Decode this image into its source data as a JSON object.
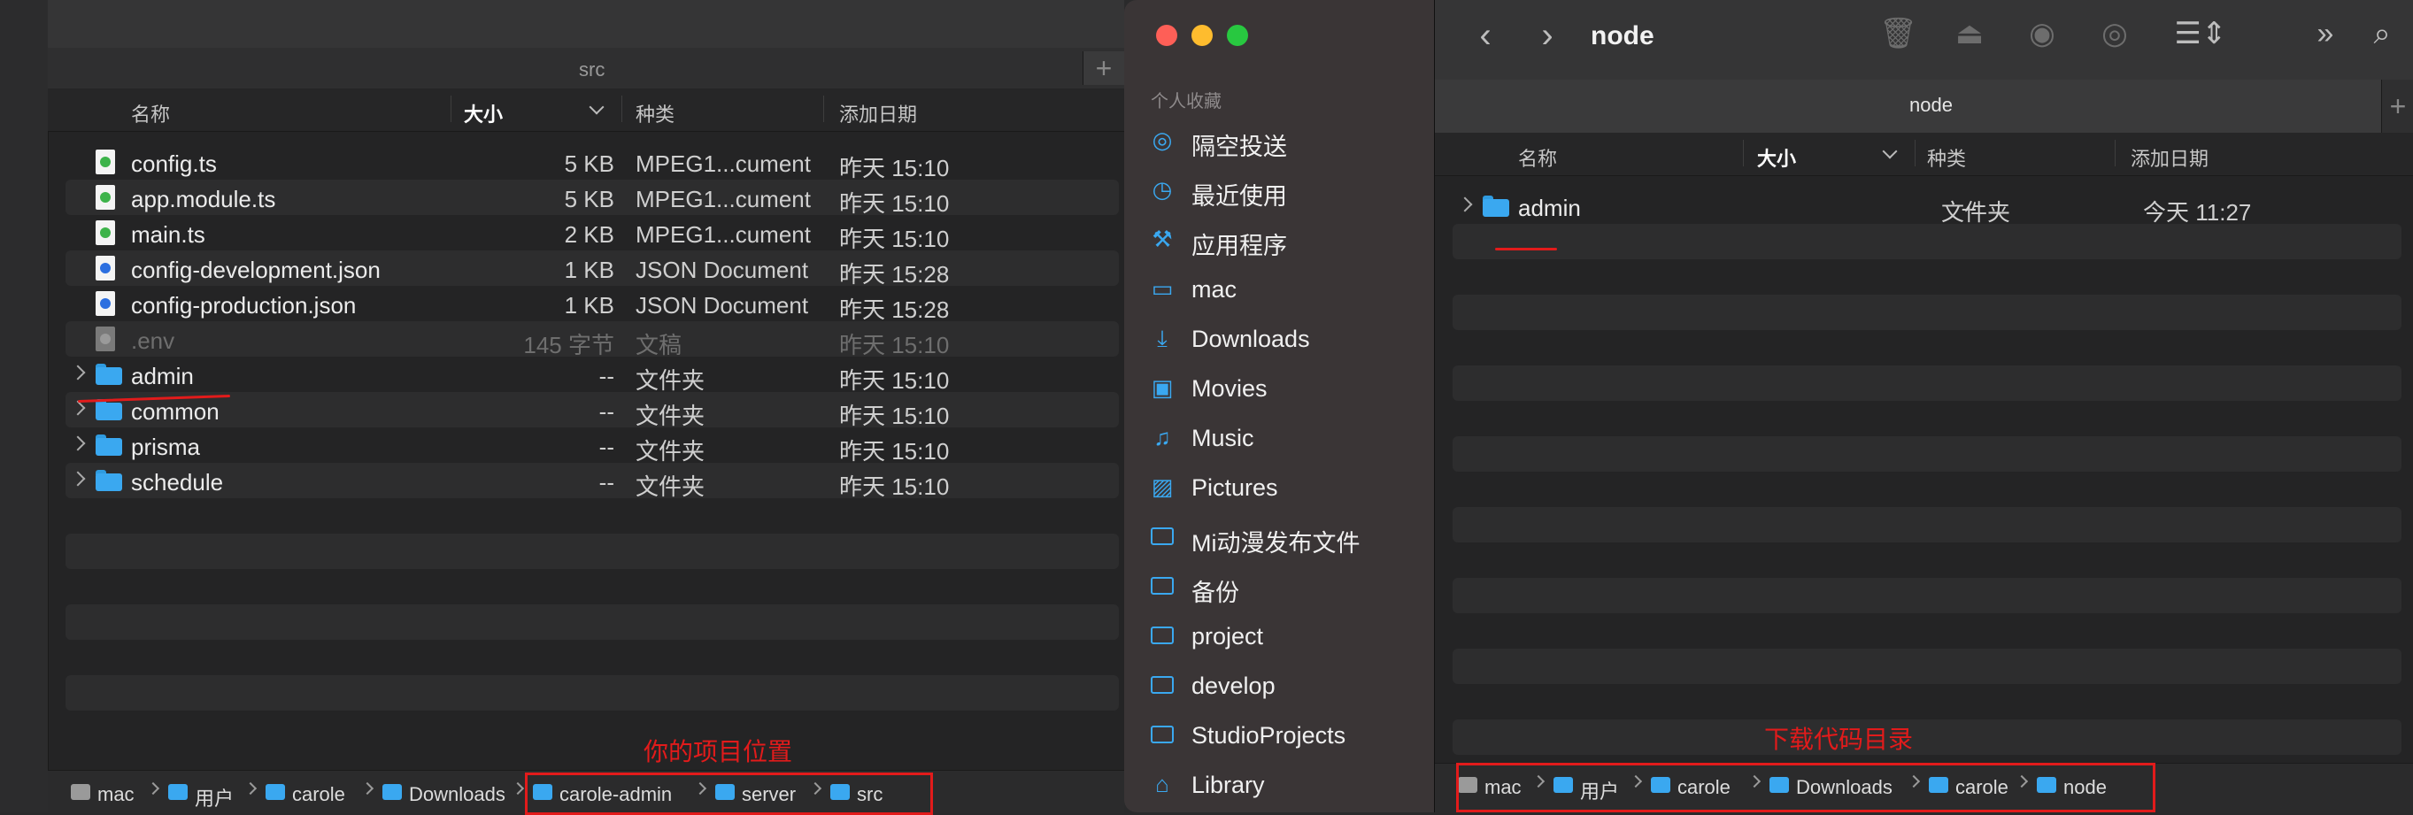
{
  "left_window": {
    "tab_title": "src",
    "columns": {
      "name": "名称",
      "size": "大小",
      "kind": "种类",
      "date": "添加日期"
    },
    "files": [
      {
        "name": "config.ts",
        "size": "5 KB",
        "kind": "MPEG1...cument",
        "date": "昨天 15:10",
        "type": "ts"
      },
      {
        "name": "app.module.ts",
        "size": "5 KB",
        "kind": "MPEG1...cument",
        "date": "昨天 15:10",
        "type": "ts"
      },
      {
        "name": "main.ts",
        "size": "2 KB",
        "kind": "MPEG1...cument",
        "date": "昨天 15:10",
        "type": "ts"
      },
      {
        "name": "config-development.json",
        "size": "1 KB",
        "kind": "JSON Document",
        "date": "昨天 15:28",
        "type": "json"
      },
      {
        "name": "config-production.json",
        "size": "1 KB",
        "kind": "JSON Document",
        "date": "昨天 15:28",
        "type": "json"
      },
      {
        "name": ".env",
        "size": "145 字节",
        "kind": "文稿",
        "date": "昨天 15:10",
        "type": "hidden"
      },
      {
        "name": "admin",
        "size": "--",
        "kind": "文件夹",
        "date": "昨天 15:10",
        "type": "folder"
      },
      {
        "name": "common",
        "size": "--",
        "kind": "文件夹",
        "date": "昨天 15:10",
        "type": "folder"
      },
      {
        "name": "prisma",
        "size": "--",
        "kind": "文件夹",
        "date": "昨天 15:10",
        "type": "folder"
      },
      {
        "name": "schedule",
        "size": "--",
        "kind": "文件夹",
        "date": "昨天 15:10",
        "type": "folder"
      }
    ],
    "path": [
      "mac",
      "用户",
      "carole",
      "Downloads",
      "carole-admin",
      "server",
      "src"
    ],
    "annotation": "你的项目位置"
  },
  "sidebar": {
    "section": "个人收藏",
    "items": [
      {
        "label": "隔空投送",
        "icon": "airdrop-icon"
      },
      {
        "label": "最近使用",
        "icon": "clock-icon"
      },
      {
        "label": "应用程序",
        "icon": "applications-icon"
      },
      {
        "label": "mac",
        "icon": "disk-icon"
      },
      {
        "label": "Downloads",
        "icon": "download-icon"
      },
      {
        "label": "Movies",
        "icon": "film-icon"
      },
      {
        "label": "Music",
        "icon": "music-icon"
      },
      {
        "label": "Pictures",
        "icon": "photo-icon"
      },
      {
        "label": "Mi动漫发布文件",
        "icon": "folder-icon"
      },
      {
        "label": "备份",
        "icon": "folder-icon"
      },
      {
        "label": "project",
        "icon": "folder-icon"
      },
      {
        "label": "develop",
        "icon": "folder-icon"
      },
      {
        "label": "StudioProjects",
        "icon": "folder-icon"
      },
      {
        "label": "Library",
        "icon": "library-icon"
      }
    ]
  },
  "right_window": {
    "title": "node",
    "tab_title": "node",
    "columns": {
      "name": "名称",
      "size": "大小",
      "kind": "种类",
      "date": "添加日期"
    },
    "files": [
      {
        "name": "admin",
        "size": "--",
        "kind": "文件夹",
        "date": "今天 11:27",
        "type": "folder"
      }
    ],
    "path": [
      "mac",
      "用户",
      "carole",
      "Downloads",
      "carole",
      "node"
    ],
    "annotation": "下载代码目录"
  },
  "colors": {
    "annotation_red": "#e21b1b",
    "folder_blue": "#3aa8f0",
    "window_bg": "#242425"
  }
}
